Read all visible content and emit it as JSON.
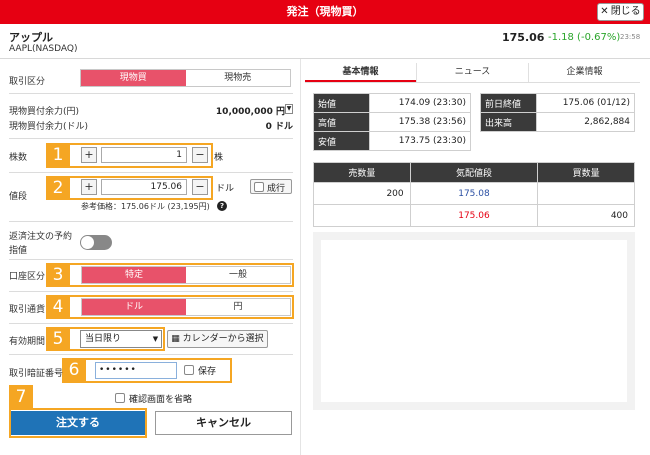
{
  "window": {
    "title": "発注（現物買）",
    "close_label": "閉じる"
  },
  "stock": {
    "name": "アップル",
    "code": "AAPL(NASDAQ)",
    "price": "175.06",
    "change": "-1.18 (-0.67%)",
    "time": "23:58"
  },
  "order_form": {
    "trade_type": {
      "label": "取引区分",
      "options": [
        "現物買",
        "現物売"
      ],
      "selected": "現物買"
    },
    "buying_power_jpy": {
      "label": "現物買付余力(円)",
      "value": "10,000,000 円"
    },
    "buying_power_usd": {
      "label": "現物買付余力(ドル)",
      "value": "0 ドル"
    },
    "quantity": {
      "label": "株数",
      "value": "1",
      "unit": "株"
    },
    "price": {
      "label": "値段",
      "value": "175.06",
      "unit": "ドル",
      "market_order_label": "成行"
    },
    "reference_price": "参考価格：175.06ドル (23,195円)",
    "reserve_toggle_label_1": "返済注文の予約",
    "reserve_toggle_label_2": "指値",
    "account_type": {
      "label": "口座区分",
      "options": [
        "特定",
        "一般"
      ],
      "selected": "特定"
    },
    "currency": {
      "label": "取引通貨",
      "options": [
        "ドル",
        "円"
      ],
      "selected": "ドル"
    },
    "validity": {
      "label": "有効期間",
      "selected": "当日限り",
      "calendar_label": "カレンダーから選択"
    },
    "pin": {
      "label": "取引暗証番号",
      "value": "••••••",
      "save_label": "保存"
    },
    "skip_confirm_label": "確認画面を省略",
    "submit_label": "注文する",
    "cancel_label": "キャンセル"
  },
  "callouts": [
    "1",
    "2",
    "3",
    "4",
    "5",
    "6",
    "7"
  ],
  "right_panel": {
    "tabs": [
      "基本情報",
      "ニュース",
      "企業情報"
    ],
    "left_info": [
      {
        "label": "始値",
        "value": "174.09 (23:30)"
      },
      {
        "label": "高値",
        "value": "175.38 (23:56)"
      },
      {
        "label": "安値",
        "value": "173.75 (23:30)"
      }
    ],
    "right_info": [
      {
        "label": "前日終値",
        "value": "175.06 (01/12)"
      },
      {
        "label": "出来高",
        "value": "2,862,884"
      }
    ],
    "board": {
      "headers": [
        "売数量",
        "気配値段",
        "買数量"
      ],
      "rows": [
        {
          "sell": "200",
          "price": "175.08",
          "buy": ""
        },
        {
          "sell": "",
          "price": "175.06",
          "buy": "400"
        }
      ]
    }
  },
  "colors": {
    "brand_red": "#e60012",
    "callout_orange": "#f5a623",
    "submit_blue": "#1f73b7",
    "active_pink": "#e8526a"
  }
}
